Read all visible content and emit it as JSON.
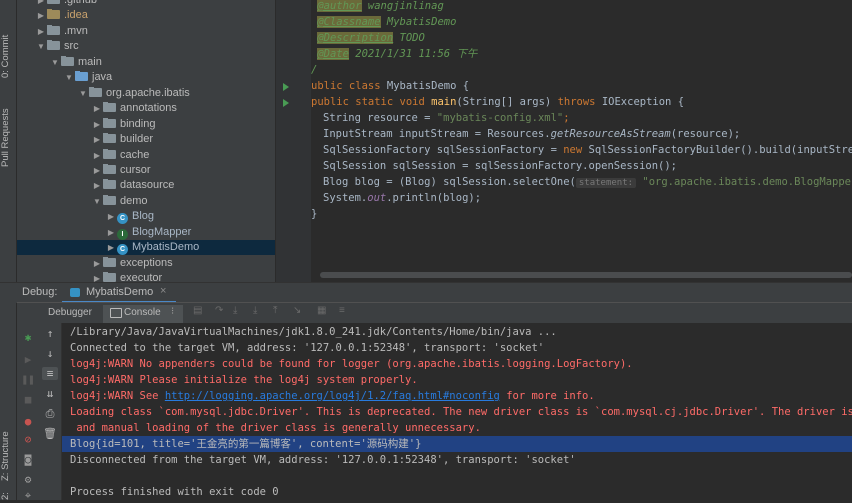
{
  "sidebar": {
    "commit_tab": "0: Commit",
    "pull_requests_tab": "Pull Requests",
    "structure_tab": "Z: Structure",
    "favorites_tab": "2: Favorites"
  },
  "tree": {
    "items": [
      {
        "label": ".github",
        "indent": 1,
        "icon": "folder",
        "arrow": "▶"
      },
      {
        "label": ".idea",
        "indent": 1,
        "icon": "folder-idea",
        "arrow": "▶"
      },
      {
        "label": ".mvn",
        "indent": 1,
        "icon": "folder",
        "arrow": "▶"
      },
      {
        "label": "src",
        "indent": 1,
        "icon": "folder",
        "arrow": "▼"
      },
      {
        "label": "main",
        "indent": 2,
        "icon": "folder",
        "arrow": "▼"
      },
      {
        "label": "java",
        "indent": 3,
        "icon": "folder-src",
        "arrow": "▼"
      },
      {
        "label": "org.apache.ibatis",
        "indent": 4,
        "icon": "package",
        "arrow": "▼"
      },
      {
        "label": "annotations",
        "indent": 5,
        "icon": "package",
        "arrow": "▶"
      },
      {
        "label": "binding",
        "indent": 5,
        "icon": "package",
        "arrow": "▶"
      },
      {
        "label": "builder",
        "indent": 5,
        "icon": "package",
        "arrow": "▶"
      },
      {
        "label": "cache",
        "indent": 5,
        "icon": "package",
        "arrow": "▶"
      },
      {
        "label": "cursor",
        "indent": 5,
        "icon": "package",
        "arrow": "▶"
      },
      {
        "label": "datasource",
        "indent": 5,
        "icon": "package",
        "arrow": "▶"
      },
      {
        "label": "demo",
        "indent": 5,
        "icon": "package",
        "arrow": "▼"
      },
      {
        "label": "Blog",
        "indent": 6,
        "icon": "class",
        "arrow": "▶"
      },
      {
        "label": "BlogMapper",
        "indent": 6,
        "icon": "interface",
        "arrow": "▶"
      },
      {
        "label": "MybatisDemo",
        "indent": 6,
        "icon": "class",
        "arrow": "▶",
        "selected": true
      },
      {
        "label": "exceptions",
        "indent": 5,
        "icon": "package",
        "arrow": "▶"
      },
      {
        "label": "executor",
        "indent": 5,
        "icon": "package",
        "arrow": "▶"
      }
    ]
  },
  "editor": {
    "lines": {
      "author": " @author wangjinlinag",
      "classname": " @Classname MybatisDemo",
      "description": " @Description TODO",
      "date": " @Date 2021/1/31 11:56 下午",
      "doc_end": "/",
      "class_decl_kw": "ublic class",
      "class_name": " MybatisDemo {",
      "main_kw": "public static void",
      "main_name": "main",
      "main_args": "(String[] args) ",
      "throws_kw": "throws",
      "throws_type": " IOException {",
      "l1a": "String resource = ",
      "l1b": "\"mybatis-config.xml\"",
      "l1c": ";",
      "l2a": "InputStream inputStream = Resources.",
      "l2b": "getResourceAsStream",
      "l2c": "(resource);",
      "l3a": "SqlSessionFactory sqlSessionFactory = ",
      "l3b": "new",
      "l3c": " SqlSessionFactoryBuilder().build(inputStream);",
      "l4": "SqlSession sqlSession = sqlSessionFactory.openSession();",
      "l5a": "Blog blog = (Blog) sqlSession.selectOne(",
      "l5hint": "statement:",
      "l5b": " \"org.apache.ibatis.demo.BlogMapper.s",
      "l6a": "System.",
      "l6b": "out",
      "l6c": ".println(blog);",
      "close": "}"
    }
  },
  "debug": {
    "label": "Debug:",
    "session_tab": "MybatisDemo",
    "debugger_tab": "Debugger",
    "console_tab": "Console"
  },
  "console": {
    "lines": [
      {
        "text": "/Library/Java/JavaVirtualMachines/jdk1.8.0_241.jdk/Contents/Home/bin/java ...",
        "style": "norm"
      },
      {
        "text": "Connected to the target VM, address: '127.0.0.1:52348', transport: 'socket'",
        "style": "norm"
      },
      {
        "text": "log4j:WARN No appenders could be found for logger (org.apache.ibatis.logging.LogFactory).",
        "style": "err"
      },
      {
        "text": "log4j:WARN Please initialize the log4j system properly.",
        "style": "err"
      },
      {
        "text": "Loading class `com.mysql.jdbc.Driver'. This is deprecated. The new driver class is `com.mysql.cj.jdbc.Driver'. The driver is au",
        "style": "err"
      },
      {
        "text": " and manual loading of the driver class is generally unnecessary.",
        "style": "err"
      },
      {
        "text": "Blog{id=101, title='王金亮的第一篇博客', content='源码构建'}",
        "style": "norm",
        "selected": true
      },
      {
        "text": "Disconnected from the target VM, address: '127.0.0.1:52348', transport: 'socket'",
        "style": "norm"
      },
      {
        "text": "",
        "style": "norm"
      },
      {
        "text": "Process finished with exit code 0",
        "style": "norm"
      }
    ],
    "warn_see_prefix": "log4j:WARN See ",
    "warn_see_link": "http://logging.apache.org/log4j/1.2/faq.html#noconfig",
    "warn_see_suffix": " for more info."
  }
}
